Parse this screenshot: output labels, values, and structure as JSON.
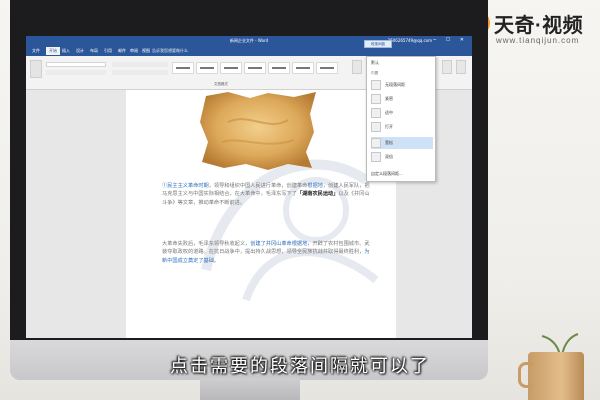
{
  "window": {
    "title": "新闻企业文件 - Word",
    "user": "2506265749@qq.com",
    "controls": "─ ☐ ✕"
  },
  "tabs": [
    {
      "label": "文件"
    },
    {
      "label": "开始",
      "active": true
    },
    {
      "label": "插入"
    },
    {
      "label": "设计"
    },
    {
      "label": "布局"
    },
    {
      "label": "引用"
    },
    {
      "label": "邮件"
    },
    {
      "label": "审阅"
    },
    {
      "label": "视图"
    }
  ],
  "tellme": "告诉我您想要做什么",
  "ribbon": {
    "styles_group_label": "文档格式"
  },
  "dropdown": {
    "toggle_label": "段落间距",
    "header": "默认",
    "section_label": "内置",
    "items": [
      {
        "label": "无段落间距"
      },
      {
        "label": "紧密"
      },
      {
        "label": "适中"
      },
      {
        "label": "打开"
      },
      {
        "label": "宽松",
        "selected": true
      },
      {
        "label": "双倍"
      }
    ],
    "custom_label": "自定义段落间距..."
  },
  "document": {
    "para1": [
      {
        "t": "①民主主义革命时期",
        "c": "hl"
      },
      {
        "t": "，领导和组织中国人民进行革命，创建革命",
        "c": ""
      },
      {
        "t": "根据地",
        "c": "hl"
      },
      {
        "t": "，创建人民军队，把马克思主义与中国实际相结合，在大革命中，毛泽东写下了",
        "c": ""
      },
      {
        "t": "「湖南农民运动」",
        "c": "strong"
      },
      {
        "t": "以及《井冈山斗争》等文章，推动革命不断前进。",
        "c": ""
      }
    ],
    "para2": [
      {
        "t": "大革命失败后，毛泽东领导秋收起义",
        "c": ""
      },
      {
        "t": "，创建了井冈山革命根据地",
        "c": "hl"
      },
      {
        "t": "，开辟了农村包围城市、武装夺取政权的道路。在抗日战争中，提出持久战思想，领导全民族抗战并取得最终胜利，",
        "c": ""
      },
      {
        "t": "为新中国成立奠定了基础",
        "c": "hl"
      },
      {
        "t": "。",
        "c": ""
      }
    ]
  },
  "logo": {
    "name": "天奇·视频",
    "url": "www.tianqijun.com"
  },
  "subtitle": "点击需要的段落间隔就可以了",
  "colors": {
    "word_blue": "#2b579a",
    "brand_orange": "#f49a2b",
    "link_blue": "#2f6fbf"
  }
}
